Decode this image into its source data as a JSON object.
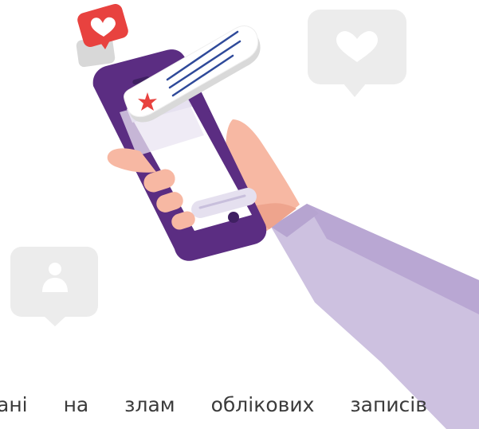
{
  "caption": {
    "text": "ані на злам облікових записів"
  },
  "icons": {
    "like_notification": "heart-icon",
    "bubble_right": "heart-icon",
    "bubble_left": "user-icon",
    "card_star": "star-icon"
  },
  "colors": {
    "background": "#ffffff",
    "phone_body": "#5b2d82",
    "screen": "#ffffff",
    "screen_shadow": "#dcd5ea",
    "notification_red": "#e8423f",
    "bubble_gray": "#ececec",
    "card_lines": "#2f4a9a",
    "skin": "#f7b8a3",
    "sleeve": "#cdc1e0",
    "sleeve_shadow": "#b9a7d3",
    "caption_text": "#3b3b3b"
  }
}
